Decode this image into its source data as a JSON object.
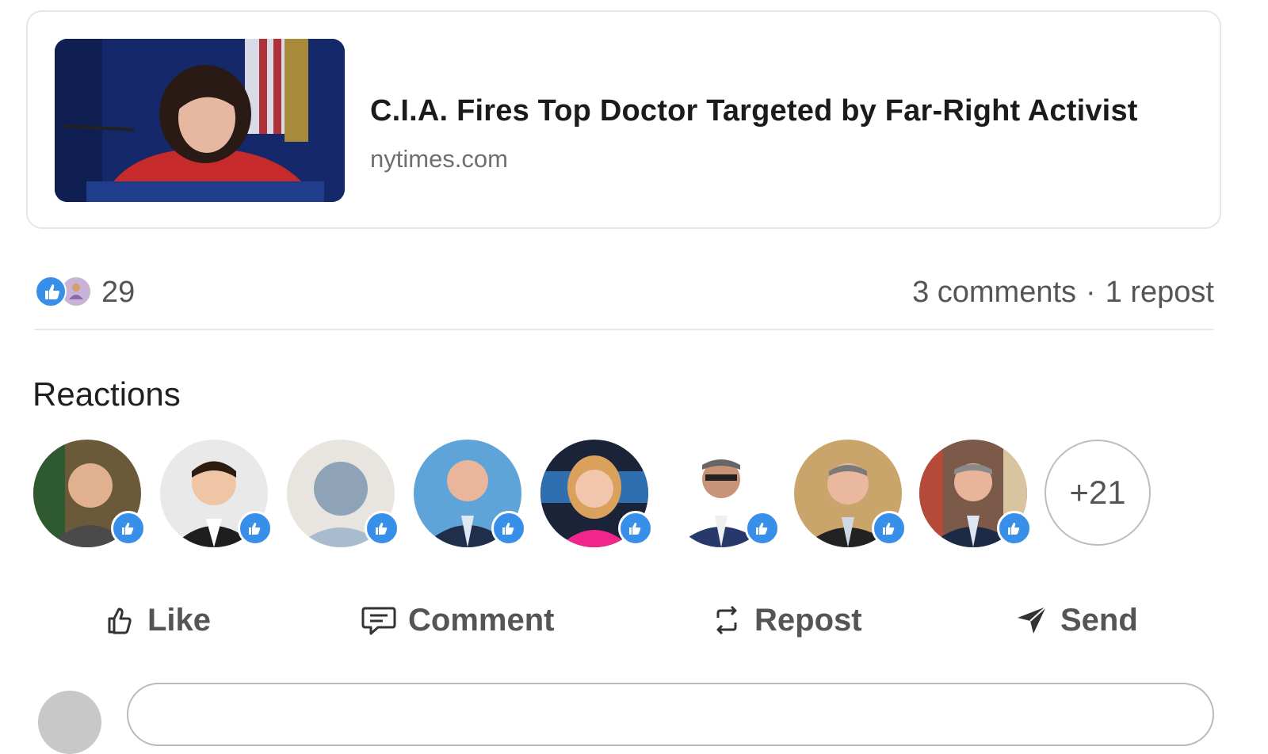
{
  "article": {
    "title": "C.I.A. Fires Top Doctor Targeted by Far-Right Activist",
    "source": "nytimes.com",
    "image": "news-photo-woman-speaking-at-podium"
  },
  "social": {
    "reaction_count": "29",
    "comments": "3 comments",
    "separator": "·",
    "reposts": "1 repost",
    "reaction_icons": [
      "like-icon",
      "celebrate-icon"
    ]
  },
  "reactions": {
    "heading": "Reactions",
    "more_label": "+21",
    "reactors": [
      {
        "avatar": "man-casual-outdoor",
        "reaction": "like"
      },
      {
        "avatar": "man-suit-light-bg",
        "reaction": "like"
      },
      {
        "avatar": "default-placeholder",
        "reaction": "like"
      },
      {
        "avatar": "man-suit-blue-bg",
        "reaction": "like"
      },
      {
        "avatar": "woman-pink-top",
        "reaction": "like"
      },
      {
        "avatar": "man-glasses-white-bg",
        "reaction": "like"
      },
      {
        "avatar": "man-suit-beige-bg",
        "reaction": "like"
      },
      {
        "avatar": "man-street-bg",
        "reaction": "like"
      }
    ]
  },
  "actions": {
    "like": "Like",
    "comment": "Comment",
    "repost": "Repost",
    "send": "Send"
  },
  "colors": {
    "like_blue": "#378fe9",
    "text_muted": "#555555",
    "title_text": "#1b1b1b"
  }
}
